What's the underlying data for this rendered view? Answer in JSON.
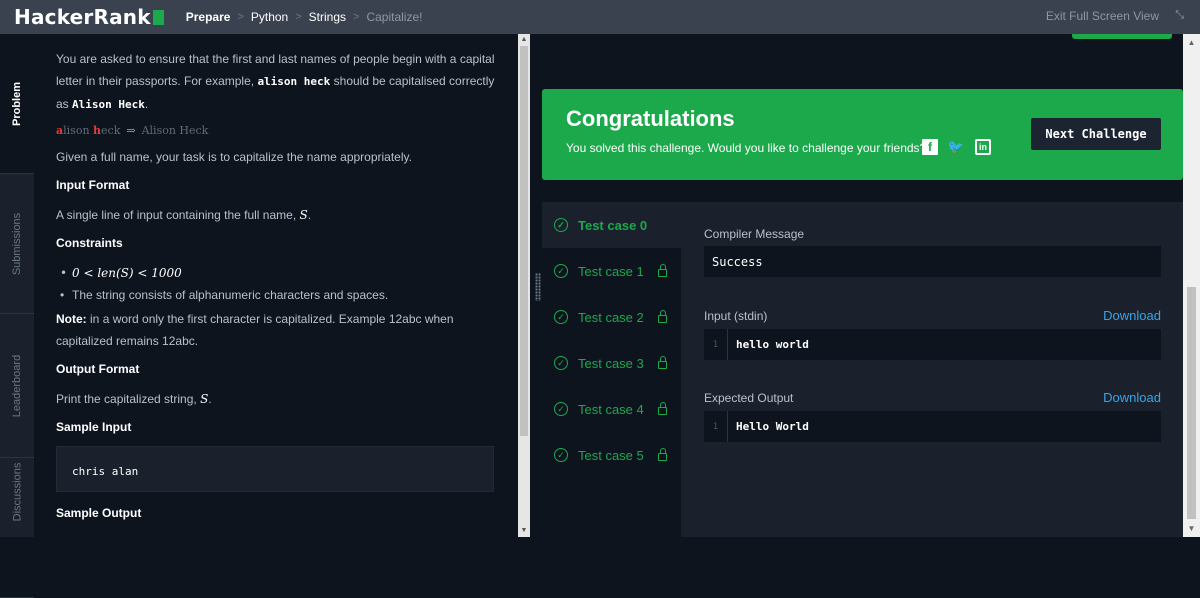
{
  "header": {
    "logo": "HackerRank",
    "breadcrumb": [
      "Prepare",
      "Python",
      "Strings",
      "Capitalize!"
    ],
    "exit_label": "Exit Full Screen View",
    "exit_icon": "collapse-icon"
  },
  "sidebar_tabs": [
    "Problem",
    "Submissions",
    "Leaderboard",
    "Discussions"
  ],
  "problem": {
    "intro_1": "You are asked to ensure that the first and last names of people begin with a capital letter in their passports. For example,",
    "intro_example": "alison heck",
    "intro_2": "should be capitalised correctly as",
    "intro_result": "Alison Heck",
    "intro_end": ".",
    "cap_a": "a",
    "cap_lison": "lison ",
    "cap_h": "h",
    "cap_eck": "eck",
    "cap_arrow": "⇒",
    "cap_result": "Alison Heck",
    "task": "Given a full name, your task is to capitalize the name appropriately.",
    "input_format_heading": "Input Format",
    "input_format_text": "A single line of input containing the full name,",
    "var_s": "S",
    "constraints_heading": "Constraints",
    "constraint_1": "0 < len(S) < 1000",
    "constraint_2": "The string consists of alphanumeric characters and spaces.",
    "note_label": "Note:",
    "note_text": "in a word only the first character is capitalized. Example 12abc when capitalized remains 12abc.",
    "output_format_heading": "Output Format",
    "output_format_text": "Print the capitalized string,",
    "sample_input_heading": "Sample Input",
    "sample_input": "chris alan",
    "sample_output_heading": "Sample Output"
  },
  "congrats": {
    "title": "Congratulations",
    "subtitle": "You solved this challenge. Would you like to challenge your friends?",
    "facebook_icon": "f",
    "twitter_icon": "🐦",
    "linkedin_icon": "in",
    "next_button": "Next Challenge"
  },
  "test_cases": [
    "Test case 0",
    "Test case 1",
    "Test case 2",
    "Test case 3",
    "Test case 4",
    "Test case 5"
  ],
  "details": {
    "compiler_label": "Compiler Message",
    "compiler_message": "Success",
    "input_label": "Input (stdin)",
    "input_download": "Download",
    "input_line_no": "1",
    "input_value": "hello world",
    "expected_label": "Expected Output",
    "expected_download": "Download",
    "expected_line_no": "1",
    "expected_value": "Hello World"
  },
  "colors": {
    "brand_green": "#1ba94c",
    "link_blue": "#3aa4e8",
    "header_bg": "#39424e",
    "page_bg": "#0e141e"
  }
}
